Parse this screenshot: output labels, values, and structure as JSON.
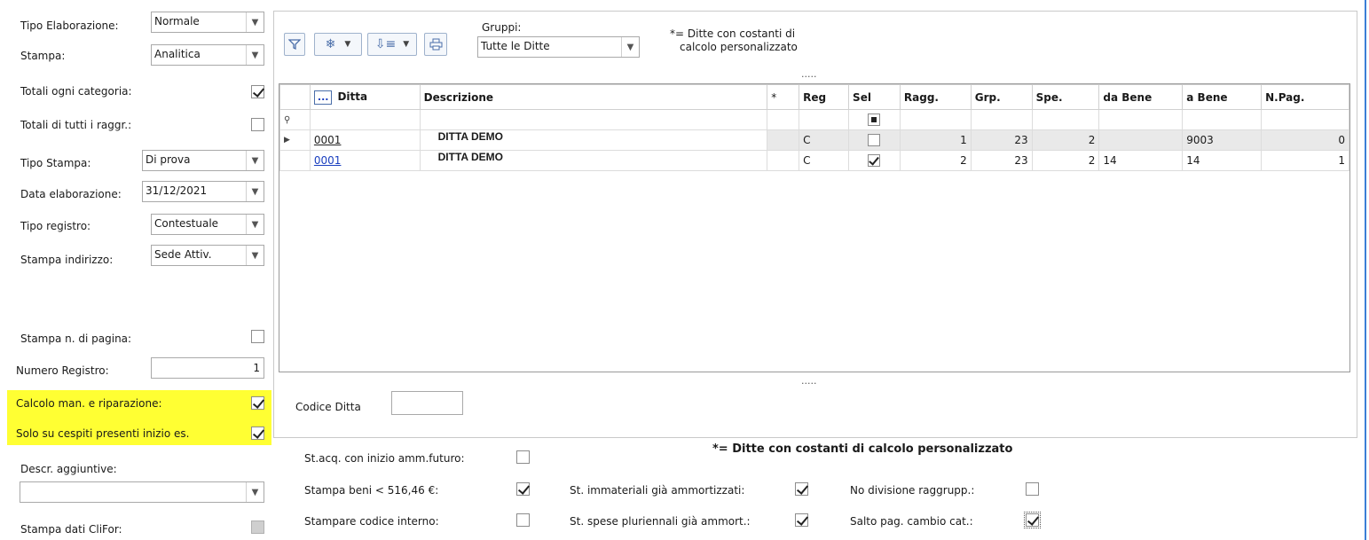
{
  "left": {
    "tipo_elaborazione": {
      "label": "Tipo Elaborazione:",
      "value": "Normale"
    },
    "stampa": {
      "label": "Stampa:",
      "value": "Analitica"
    },
    "totali_categoria": {
      "label": "Totali ogni categoria:",
      "checked": true
    },
    "totali_raggr": {
      "label": "Totali di tutti i raggr.:",
      "checked": false
    },
    "tipo_stampa": {
      "label": "Tipo Stampa:",
      "value": "Di prova"
    },
    "data_elaborazione": {
      "label": "Data elaborazione:",
      "value": "31/12/2021"
    },
    "tipo_registro": {
      "label": "Tipo registro:",
      "value": "Contestuale"
    },
    "stampa_indirizzo": {
      "label": "Stampa indirizzo:",
      "value": "Sede Attiv."
    },
    "stampa_n_pagina": {
      "label": "Stampa n. di pagina:",
      "checked": false
    },
    "numero_registro": {
      "label": "Numero Registro:",
      "value": "1"
    },
    "calcolo_man": {
      "label": "Calcolo man. e riparazione:",
      "checked": true
    },
    "solo_cespiti": {
      "label": "Solo su cespiti presenti inizio es.",
      "checked": true
    },
    "descr_aggiuntive": {
      "label": "Descr. aggiuntive:",
      "value": ""
    },
    "stampa_clifor": {
      "label": "Stampa dati CliFor:"
    }
  },
  "toolbar": {
    "gruppi_label": "Gruppi:",
    "gruppi_value": "Tutte le Ditte",
    "note_line1": "*= Ditte con costanti di",
    "note_line2": "calcolo personalizzato",
    "splitter_dots": "....."
  },
  "grid": {
    "headers": [
      "...",
      "Ditta",
      "Descrizione",
      "*",
      "Reg",
      "Sel",
      "Ragg.",
      "Grp.",
      "Spe.",
      "da Bene",
      "a Bene",
      "N.Pag."
    ],
    "rows": [
      {
        "ditta": "0001",
        "descrizione": "DITTA DEMO",
        "reg": "C",
        "ragg": "1",
        "grp": "23",
        "spe": "2",
        "da_bene": "",
        "a_bene": "9003",
        "npag": "0"
      },
      {
        "ditta": "0001",
        "descrizione": "DITTA DEMO",
        "reg": "C",
        "ragg": "2",
        "grp": "23",
        "spe": "2",
        "da_bene": "14",
        "a_bene": "14",
        "npag": "1"
      }
    ]
  },
  "codice_ditta": {
    "label": "Codice Ditta",
    "value": ""
  },
  "bottom": {
    "legend": "*= Ditte con costanti di calcolo personalizzato",
    "st_acq": {
      "label": "St.acq. con inizio amm.futuro:",
      "checked": false
    },
    "stampa_beni": {
      "label": "Stampa beni < 516,46 €:",
      "checked": true
    },
    "stampare_codice": {
      "label": "Stampare codice interno:",
      "checked": false
    },
    "st_immateriali": {
      "label": "St. immateriali già ammortizzati:",
      "checked": true
    },
    "st_spese": {
      "label": "St. spese pluriennali già ammort.:",
      "checked": true
    },
    "no_divisione": {
      "label": "No divisione raggrupp.:",
      "checked": false
    },
    "salto_pag": {
      "label": "Salto pag. cambio cat.:",
      "checked": true
    }
  },
  "colors": {
    "highlight": "#ffff33",
    "link": "#1a3fbf",
    "accent": "#4a6ea9"
  }
}
